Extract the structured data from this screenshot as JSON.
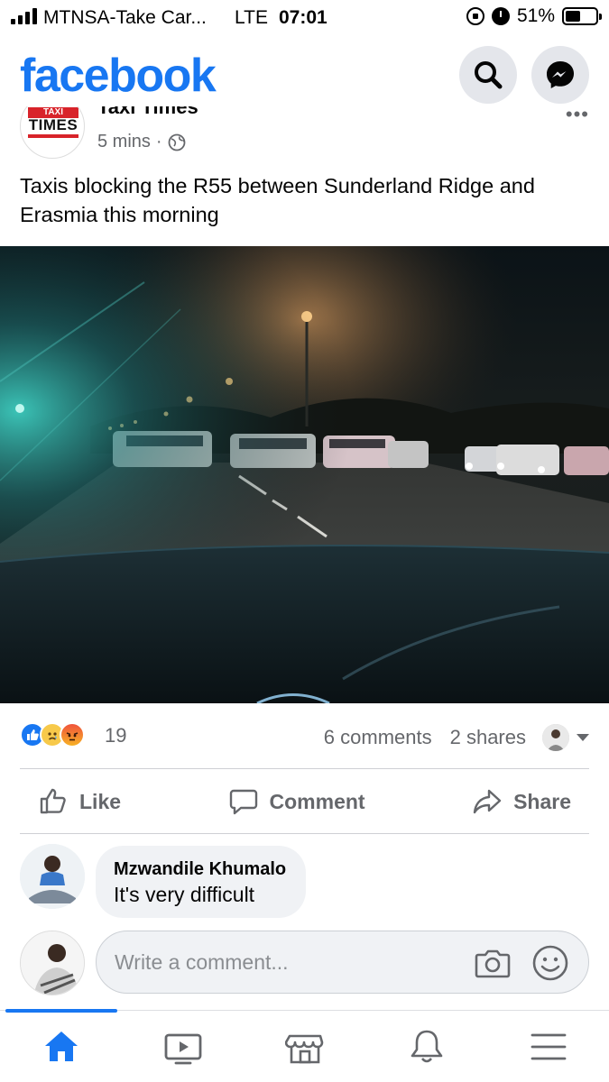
{
  "status_bar": {
    "carrier": "MTNSA-Take Car...",
    "network": "LTE",
    "time": "07:01",
    "battery": "51%",
    "battery_level": 0.51
  },
  "header": {
    "logo": "facebook",
    "brand_color": "#1877f2"
  },
  "post": {
    "page_avatar_logo_top": "TAXI",
    "page_avatar_logo_main": "TIMES",
    "page_name": "Taxi Times",
    "time": "5 mins",
    "meta_separator": "·",
    "privacy_icon": "globe-icon",
    "text": "Taxis blocking the R55 between Sunderland Ridge and Erasmia this morning",
    "photo_description_icon": "night-road-photo"
  },
  "stats": {
    "reaction_icons": [
      "like-icon",
      "sad-icon",
      "angry-icon"
    ],
    "reaction_count": "19",
    "comments": "6 comments",
    "shares": "2 shares"
  },
  "actions": {
    "like": "Like",
    "comment": "Comment",
    "share": "Share"
  },
  "comment": {
    "author": "Mzwandile Khumalo",
    "text": "It's very difficult"
  },
  "write_comment": {
    "placeholder": "Write a comment..."
  },
  "bottom_nav": {
    "items": [
      "home-icon",
      "watch-icon",
      "marketplace-icon",
      "notifications-icon",
      "menu-icon"
    ],
    "active": "home-icon"
  }
}
